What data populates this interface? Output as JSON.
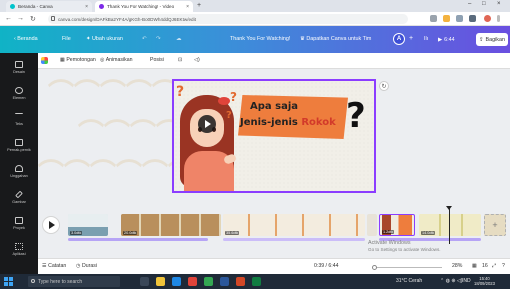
{
  "browser": {
    "tabs": [
      {
        "title": "Beranda - Canva",
        "close": "×",
        "favicon_color": "#00c4cc"
      },
      {
        "title": "Thank You For Watching! - Video",
        "close": "×",
        "favicon_color": "#7d2ae8"
      }
    ],
    "new_tab": "+",
    "url": "canva.com/design/DAFkBa2YF4A/gKGh-Bo0DWh4ddQJ6EKtw/edit",
    "window_controls": [
      "–",
      "□",
      "×"
    ]
  },
  "canva_header": {
    "home": "Beranda",
    "file": "File",
    "resize": "Ubah ukuran",
    "doc_title": "Thank You For Watching!",
    "upgrade": "Dapatkan Canva untuk Tim",
    "avatar": "A",
    "add": "+",
    "chart": "Ilı",
    "present_time": "6:44",
    "share": "Bagikan"
  },
  "rail": [
    {
      "label": "Desain"
    },
    {
      "label": "Elemen"
    },
    {
      "label": "Teks"
    },
    {
      "label": "Pernak-pernik"
    },
    {
      "label": "Unggahan"
    },
    {
      "label": "Gambar"
    },
    {
      "label": "Proyek"
    },
    {
      "label": "Aplikasi"
    }
  ],
  "toolbar": {
    "color": "",
    "transition": "Pemotongan",
    "animate": "Animasikan",
    "position": "Posisi"
  },
  "slide": {
    "title_line1": "Apa saja",
    "title_line2_plain": "Jenis-jenis",
    "title_line2_highlight": "Rokok",
    "qmark": "?",
    "watermark": "ᴗ ᴗ ᴗ"
  },
  "filmstrip": {
    "clips": [
      {
        "duration": "3.0dtk"
      },
      {
        "duration": "20.0dtk"
      },
      {
        "duration": "35.6dtk"
      },
      {
        "duration": ""
      },
      {
        "duration": "1.2dtk"
      },
      {
        "duration": "14.0dtk"
      }
    ],
    "add": "+"
  },
  "bottombar": {
    "notes": "Catatan",
    "timer": "Durasi",
    "time": "0:39 / 6:44",
    "zoom": "28%",
    "pages": "16"
  },
  "activation": {
    "title": "Activate Windows",
    "subtitle": "Go to Settings to activate Windows."
  },
  "taskbar": {
    "search_placeholder": "Type here to search",
    "weather": "31°C Cerah",
    "lang": "IND",
    "time": "15:40",
    "date": "18/09/2023"
  },
  "colors": {
    "header_start": "#10b3c6",
    "header_end": "#6a4fe0",
    "selection": "#8b3dff",
    "title_box": "#ee7d3d"
  }
}
